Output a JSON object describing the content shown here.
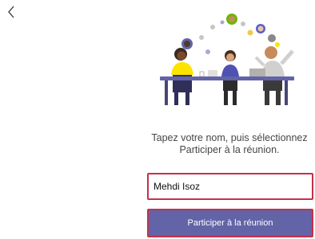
{
  "nav": {
    "back_icon": "chevron-left-icon"
  },
  "hero": {
    "image_icon": "meeting-illustration"
  },
  "prompt": {
    "line1": "Tapez votre nom, puis sélectionnez",
    "line2": "Participer à la réunion."
  },
  "name_input": {
    "value": "Mehdi Isoz"
  },
  "join": {
    "label": "Participer à la réunion"
  },
  "colors": {
    "accent": "#6264a7",
    "error_border": "#c4314b",
    "text": "#484644"
  }
}
